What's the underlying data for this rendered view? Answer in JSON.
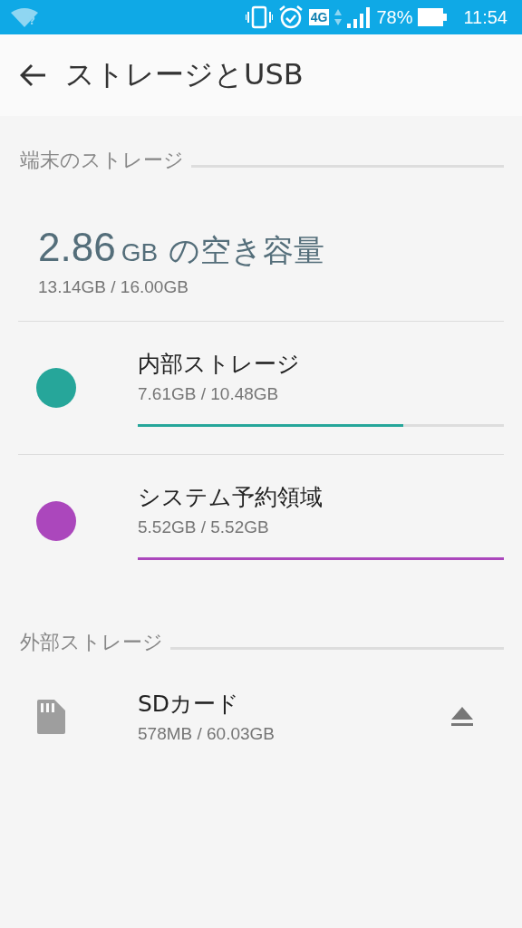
{
  "status_bar": {
    "wifi_mark": "?",
    "network": "4G",
    "battery": "78%",
    "time": "11:54"
  },
  "app_bar": {
    "title": "ストレージとUSB"
  },
  "sections": [
    {
      "title": "端末のストレージ",
      "summary": {
        "value": "2.86",
        "unit": "GB",
        "label": "の空き容量",
        "usage": "13.14GB / 16.00GB"
      },
      "items": [
        {
          "kind": "volume",
          "name": "内部ストレージ",
          "usage": "7.61GB / 10.48GB",
          "color": "#26a69a",
          "level": 0.726
        },
        {
          "kind": "volume",
          "name": "システム予約領域",
          "usage": "5.52GB / 5.52GB",
          "color": "#ab47bc",
          "level": 1
        }
      ]
    },
    {
      "title": "外部ストレージ",
      "items": [
        {
          "kind": "sdcard",
          "name": "SDカード",
          "usage": "578MB / 60.03GB"
        }
      ]
    }
  ]
}
